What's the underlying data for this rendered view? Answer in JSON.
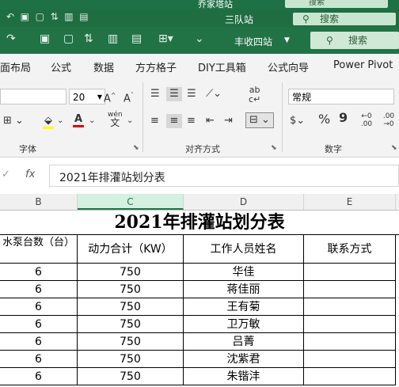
{
  "windows": [
    {
      "title": "乔家塔站",
      "search": "搜索"
    },
    {
      "title": "三队站",
      "search": "搜索"
    },
    {
      "title": "丰收四站",
      "search": "搜索"
    }
  ],
  "tabs": [
    "面布局",
    "公式",
    "数据",
    "方方格子",
    "DIY工具箱",
    "公式向导",
    "Power Pivot"
  ],
  "ribbon": {
    "font_size": "20",
    "number_format": "常规",
    "groups": {
      "font": "字体",
      "alignment": "对齐方式",
      "number": "数字"
    },
    "wen_label": "wén",
    "wen_char": "文",
    "currency_symbol": "$",
    "percent": "%",
    "comma": "9",
    "dec_inc": "←0 .00",
    "dec_dec": ".00 →0",
    "colors": {
      "highlight": "#ffff00",
      "font": "#e00000",
      "accent": "#217346"
    }
  },
  "formula_bar": {
    "fx": "fx",
    "content": "2021年排灌站划分表"
  },
  "columns": [
    "B",
    "C",
    "D",
    "E"
  ],
  "sheet": {
    "title": "2021年排灌站划分表",
    "headers": [
      "水泵台数（台）",
      "动力合计（KW）",
      "工作人员姓名",
      "联系方式"
    ],
    "rows": [
      [
        "6",
        "750",
        "华佳",
        ""
      ],
      [
        "6",
        "750",
        "蒋佳丽",
        ""
      ],
      [
        "6",
        "750",
        "王有菊",
        ""
      ],
      [
        "6",
        "750",
        "卫万敏",
        ""
      ],
      [
        "6",
        "750",
        "吕菁",
        ""
      ],
      [
        "6",
        "750",
        "沈紫君",
        ""
      ],
      [
        "6",
        "750",
        "朱锴沣",
        ""
      ]
    ]
  }
}
